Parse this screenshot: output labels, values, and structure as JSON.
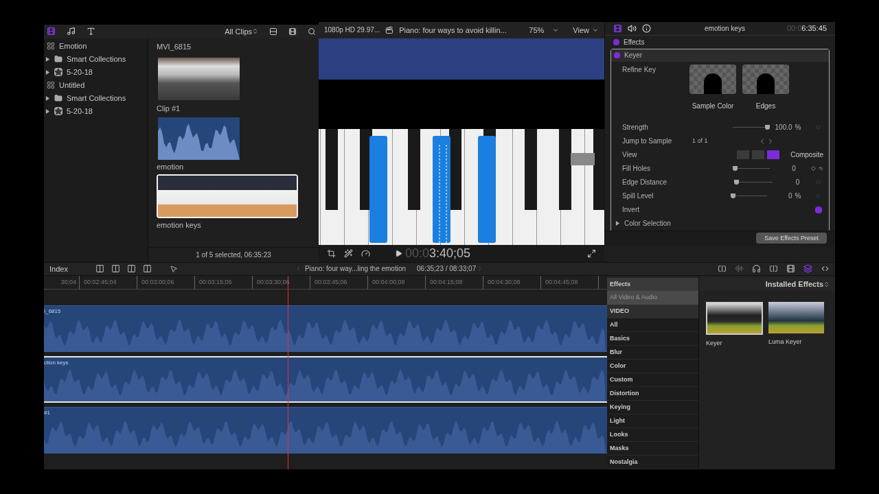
{
  "library": {
    "clip_filter": "All Clips",
    "items": [
      {
        "kind": "library",
        "label": "Emotion",
        "children": [
          {
            "kind": "folder",
            "label": "Smart Collections",
            "expanded": false
          },
          {
            "kind": "event",
            "label": "5-20-18",
            "expanded": false
          }
        ]
      },
      {
        "kind": "library",
        "label": "Untitled",
        "children": [
          {
            "kind": "folder",
            "label": "Smart Collections",
            "expanded": false
          },
          {
            "kind": "event",
            "label": "5-20-18",
            "expanded": false
          }
        ]
      }
    ]
  },
  "browser": {
    "top_label": "MVI_6815",
    "clips": [
      {
        "kind": "video",
        "name": "Clip #1",
        "selected": false
      },
      {
        "kind": "audio",
        "name": "emotion",
        "selected": false
      },
      {
        "kind": "widescreen",
        "name": "emotion keys",
        "selected": true
      }
    ],
    "status": "1 of 5 selected, 06:35:23"
  },
  "viewer": {
    "format": "1080p HD 29.97...",
    "title": "Piano: four ways to avoid killin...",
    "zoom": "75%",
    "view_menu": "View",
    "timecode_dim": "00:0",
    "timecode": "3:40;05"
  },
  "inspector": {
    "tabs": [
      {
        "kind": "video",
        "selected": true
      },
      {
        "kind": "audio",
        "selected": false
      },
      {
        "kind": "info",
        "selected": false
      }
    ],
    "clip_name": "emotion keys",
    "timecode_dim": "00:0",
    "timecode": "6:35:45",
    "effects_label": "Effects",
    "effects_enabled": true,
    "keyer": {
      "label": "Keyer",
      "enabled": true,
      "refine_label": "Refine Key",
      "refine_buttons": [
        "Sample Color",
        "Edges"
      ],
      "params": [
        {
          "kind": "slider",
          "label": "Strength",
          "level": 1,
          "value": "100.0",
          "unit": "%",
          "keyframe": false
        },
        {
          "kind": "stepper",
          "label": "Jump to Sample",
          "value": "1 of 1"
        },
        {
          "kind": "view",
          "label": "View",
          "options": [
            {
              "selected": false
            },
            {
              "selected": false
            },
            {
              "selected": true
            }
          ],
          "value": "Composite"
        },
        {
          "kind": "slider",
          "label": "Fill Holes",
          "level": 0,
          "value": "0",
          "keyframe": true
        },
        {
          "kind": "slider",
          "label": "Edge Distance",
          "level": 0,
          "value": "0",
          "keyframe": false
        },
        {
          "kind": "slider",
          "label": "Spill Level",
          "level": 0,
          "value": "0",
          "unit": "%",
          "keyframe": false
        },
        {
          "kind": "checkbox",
          "label": "Invert",
          "checked": true
        }
      ],
      "color_selection": {
        "label": "Color Selection",
        "expanded": false
      }
    },
    "save_button": "Save Effects Preset"
  },
  "timeline": {
    "index_label": "Index",
    "project_title": "Piano: four way...ling the emotion",
    "position": "06:35;23 / 08:33;07",
    "ruler": [
      "30;04",
      "00:02:45;04",
      "00:03:00;06",
      "00:03:15;06",
      "00:03:30;06",
      "00:03:45;06",
      "00:04:00;08",
      "00:04:15;08",
      "00:04:30;08",
      "00:04:45;08"
    ],
    "tracks": [
      {
        "label": "I_6815",
        "selected": false
      },
      {
        "label": "ction keys",
        "selected": true
      },
      {
        "label": "#1",
        "selected": false
      }
    ]
  },
  "effects_browser": {
    "sidebar_title": "Effects",
    "filter": "Installed Effects",
    "categories": [
      {
        "kind": "group",
        "label": "All Video & Audio",
        "selected": true
      },
      {
        "kind": "section",
        "label": "VIDEO"
      },
      {
        "kind": "item",
        "label": "All",
        "selected": false
      },
      {
        "kind": "item",
        "label": "Basics",
        "selected": false
      },
      {
        "kind": "item",
        "label": "Blur",
        "selected": false
      },
      {
        "kind": "item",
        "label": "Color",
        "selected": false
      },
      {
        "kind": "item",
        "label": "Custom",
        "selected": false
      },
      {
        "kind": "item",
        "label": "Distortion",
        "selected": false
      },
      {
        "kind": "item",
        "label": "Keying",
        "selected": false
      },
      {
        "kind": "item",
        "label": "Light",
        "selected": false
      },
      {
        "kind": "item",
        "label": "Looks",
        "selected": false
      },
      {
        "kind": "item",
        "label": "Masks",
        "selected": false
      },
      {
        "kind": "item",
        "label": "Nostalgia",
        "selected": false
      }
    ],
    "effects": [
      {
        "name": "Keyer",
        "selected": true
      },
      {
        "name": "Luma Keyer",
        "selected": false
      }
    ]
  }
}
